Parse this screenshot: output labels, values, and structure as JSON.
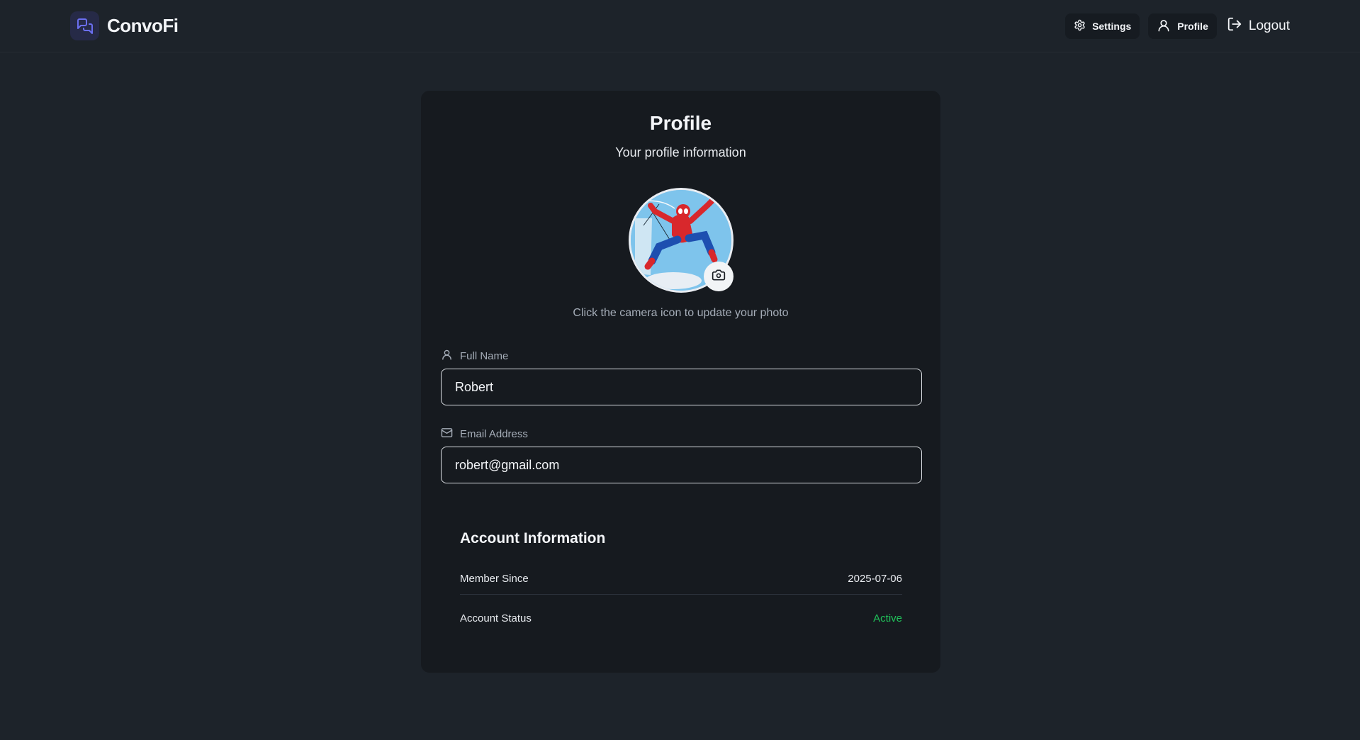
{
  "app": {
    "name": "ConvoFi"
  },
  "nav": {
    "settings_label": "Settings",
    "profile_label": "Profile",
    "logout_label": "Logout"
  },
  "profile": {
    "title": "Profile",
    "subtitle": "Your profile information",
    "avatar_hint": "Click the camera icon to update your photo",
    "full_name": {
      "label": "Full Name",
      "value": "Robert"
    },
    "email": {
      "label": "Email Address",
      "value": "robert@gmail.com"
    }
  },
  "account": {
    "title": "Account Information",
    "member_since_label": "Member Since",
    "member_since_value": "2025-07-06",
    "status_label": "Account Status",
    "status_value": "Active"
  },
  "colors": {
    "background": "#1d232a",
    "card": "#161a1f",
    "brand_accent": "#6b6ff0",
    "status_active": "#20c25a"
  },
  "icons": {
    "brand": "chat-bubbles-icon",
    "settings": "gear-icon",
    "profile": "user-icon",
    "logout": "logout-icon",
    "camera": "camera-icon",
    "full_name": "user-icon",
    "email": "mail-icon"
  }
}
